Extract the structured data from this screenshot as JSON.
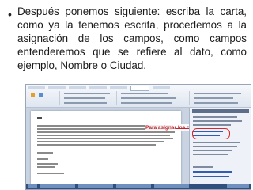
{
  "slide": {
    "bullet_symbol": "•",
    "text": "Después ponemos siguiente: escriba la carta, como ya la tenemos escrita, procedemos a la asignación de los campos, como campos entenderemos que se refiere al dato, como ejemplo, Nombre o Ciudad."
  },
  "screenshot": {
    "callout_text": "Para asignar los campos en nuestra carta",
    "callout_color": "#c0262c",
    "highlight_color": "#d9262c"
  }
}
